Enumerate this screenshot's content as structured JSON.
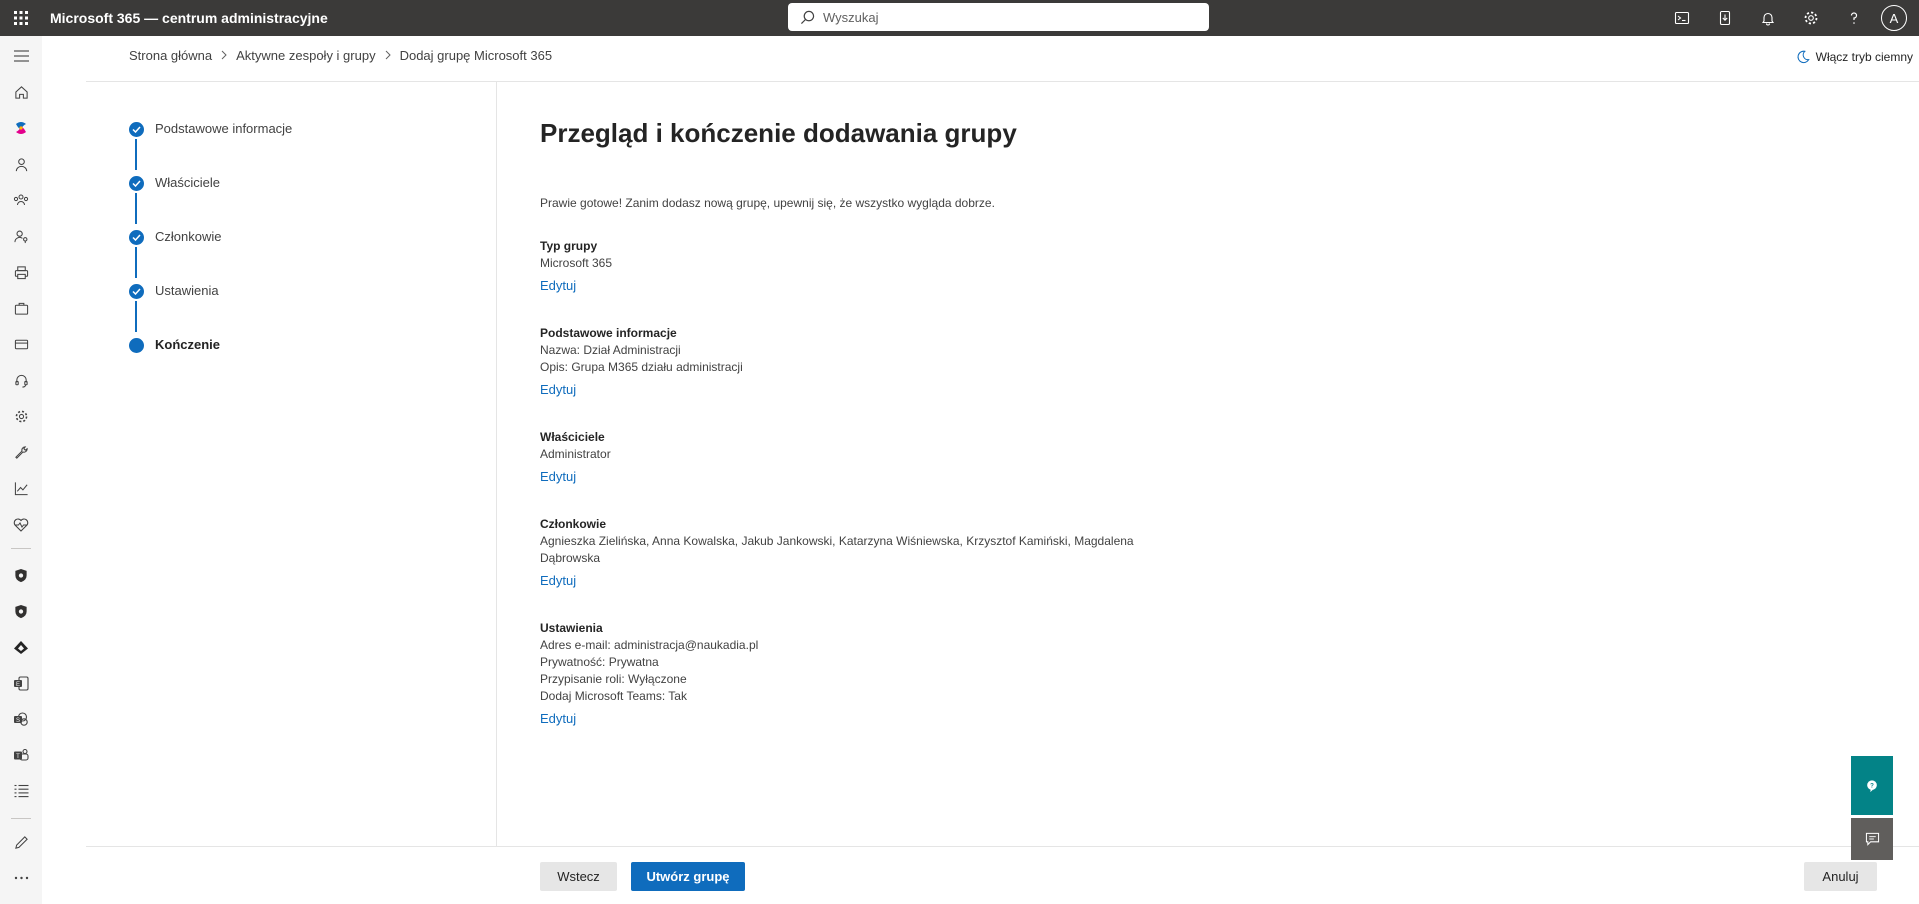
{
  "app": {
    "title": "Microsoft 365 — centrum administracyjne",
    "avatar_initial": "A"
  },
  "search": {
    "placeholder": "Wyszukaj"
  },
  "topbar_icons": [
    "terminal-icon",
    "mobile-download-icon",
    "bell-icon",
    "gear-icon",
    "help-icon"
  ],
  "rail_icons": [
    "menu-icon",
    "home-icon",
    "copilot-icon",
    "user-icon",
    "team-icon",
    "user-key-icon",
    "printer-icon",
    "briefcase-icon",
    "credit-card-icon",
    "headset-icon",
    "gear-icon",
    "wrench-icon",
    "chart-icon",
    "health-icon",
    "shield-icon",
    "shield-icon",
    "azure-icon",
    "exchange-icon",
    "sharepoint-icon",
    "teams-icon",
    "list-icon",
    "pencil-icon",
    "more-icon"
  ],
  "breadcrumb": {
    "items": [
      "Strona główna",
      "Aktywne zespoły i grupy",
      "Dodaj grupę Microsoft 365"
    ]
  },
  "dark_mode": {
    "label": "Włącz tryb ciemny"
  },
  "steps": [
    {
      "label": "Podstawowe informacje",
      "state": "done"
    },
    {
      "label": "Właściciele",
      "state": "done"
    },
    {
      "label": "Członkowie",
      "state": "done"
    },
    {
      "label": "Ustawienia",
      "state": "done"
    },
    {
      "label": "Kończenie",
      "state": "current"
    }
  ],
  "main": {
    "title": "Przegląd i kończenie dodawania grupy",
    "intro": "Prawie gotowe! Zanim dodasz nową grupę, upewnij się, że wszystko wygląda dobrze.",
    "edit_label": "Edytuj",
    "sections": {
      "group_type": {
        "title": "Typ grupy",
        "lines": [
          "Microsoft 365"
        ]
      },
      "basics": {
        "title": "Podstawowe informacje",
        "lines": [
          "Nazwa: Dział Administracji",
          "Opis: Grupa M365 działu administracji"
        ]
      },
      "owners": {
        "title": "Właściciele",
        "lines": [
          "Administrator"
        ]
      },
      "members": {
        "title": "Członkowie",
        "lines": [
          "Agnieszka Zielińska, Anna Kowalska, Jakub Jankowski, Katarzyna Wiśniewska, Krzysztof Kamiński, Magdalena",
          "Dąbrowska"
        ]
      },
      "settings": {
        "title": "Ustawienia",
        "lines": [
          "Adres e-mail: administracja@naukadia.pl",
          "Prywatność: Prywatna",
          "Przypisanie roli: Wyłączone",
          "Dodaj Microsoft Teams: Tak"
        ]
      }
    }
  },
  "footer": {
    "back_label": "Wstecz",
    "create_label": "Utwórz grupę",
    "cancel_label": "Anuluj"
  },
  "colors": {
    "topbar": "#3b3a39",
    "accent": "#0f6cbd",
    "help_fab": "#038387"
  }
}
